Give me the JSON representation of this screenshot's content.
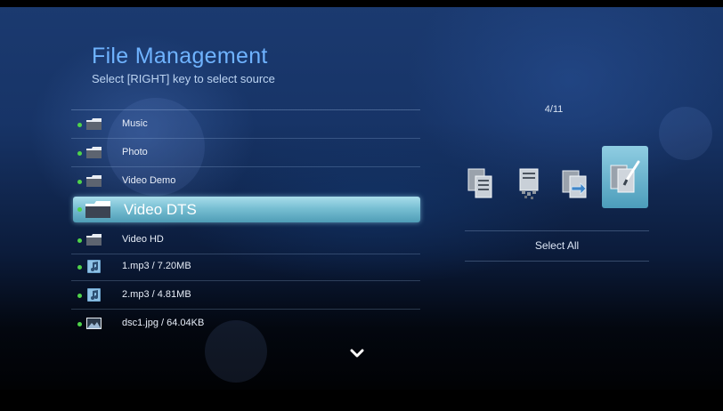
{
  "header": {
    "title": "File Management",
    "subtitle": "Select [RIGHT] key to select source"
  },
  "file_list": {
    "items": [
      {
        "label": "Music",
        "icon": "folder-icon"
      },
      {
        "label": "Photo",
        "icon": "folder-icon"
      },
      {
        "label": "Video Demo",
        "icon": "folder-icon"
      },
      {
        "label": "Video DTS",
        "icon": "folder-icon",
        "selected": true
      },
      {
        "label": "Video HD",
        "icon": "folder-icon"
      },
      {
        "label": "1.mp3 / 7.20MB",
        "icon": "music-file-icon"
      },
      {
        "label": "2.mp3 / 4.81MB",
        "icon": "music-file-icon"
      },
      {
        "label": "dsc1.jpg / 64.04KB",
        "icon": "image-file-icon"
      }
    ],
    "more_indicator": "chevron-down-icon"
  },
  "actions": {
    "page_counter": "4/11",
    "icons": [
      "copy-icon",
      "delete-icon",
      "move-icon",
      "select-icon"
    ],
    "selected_icon": "select-icon",
    "select_all_label": "Select All"
  },
  "colors": {
    "title": "#6fb3ff",
    "selection": "#78bfd3",
    "bullet": "#4fd34a"
  }
}
